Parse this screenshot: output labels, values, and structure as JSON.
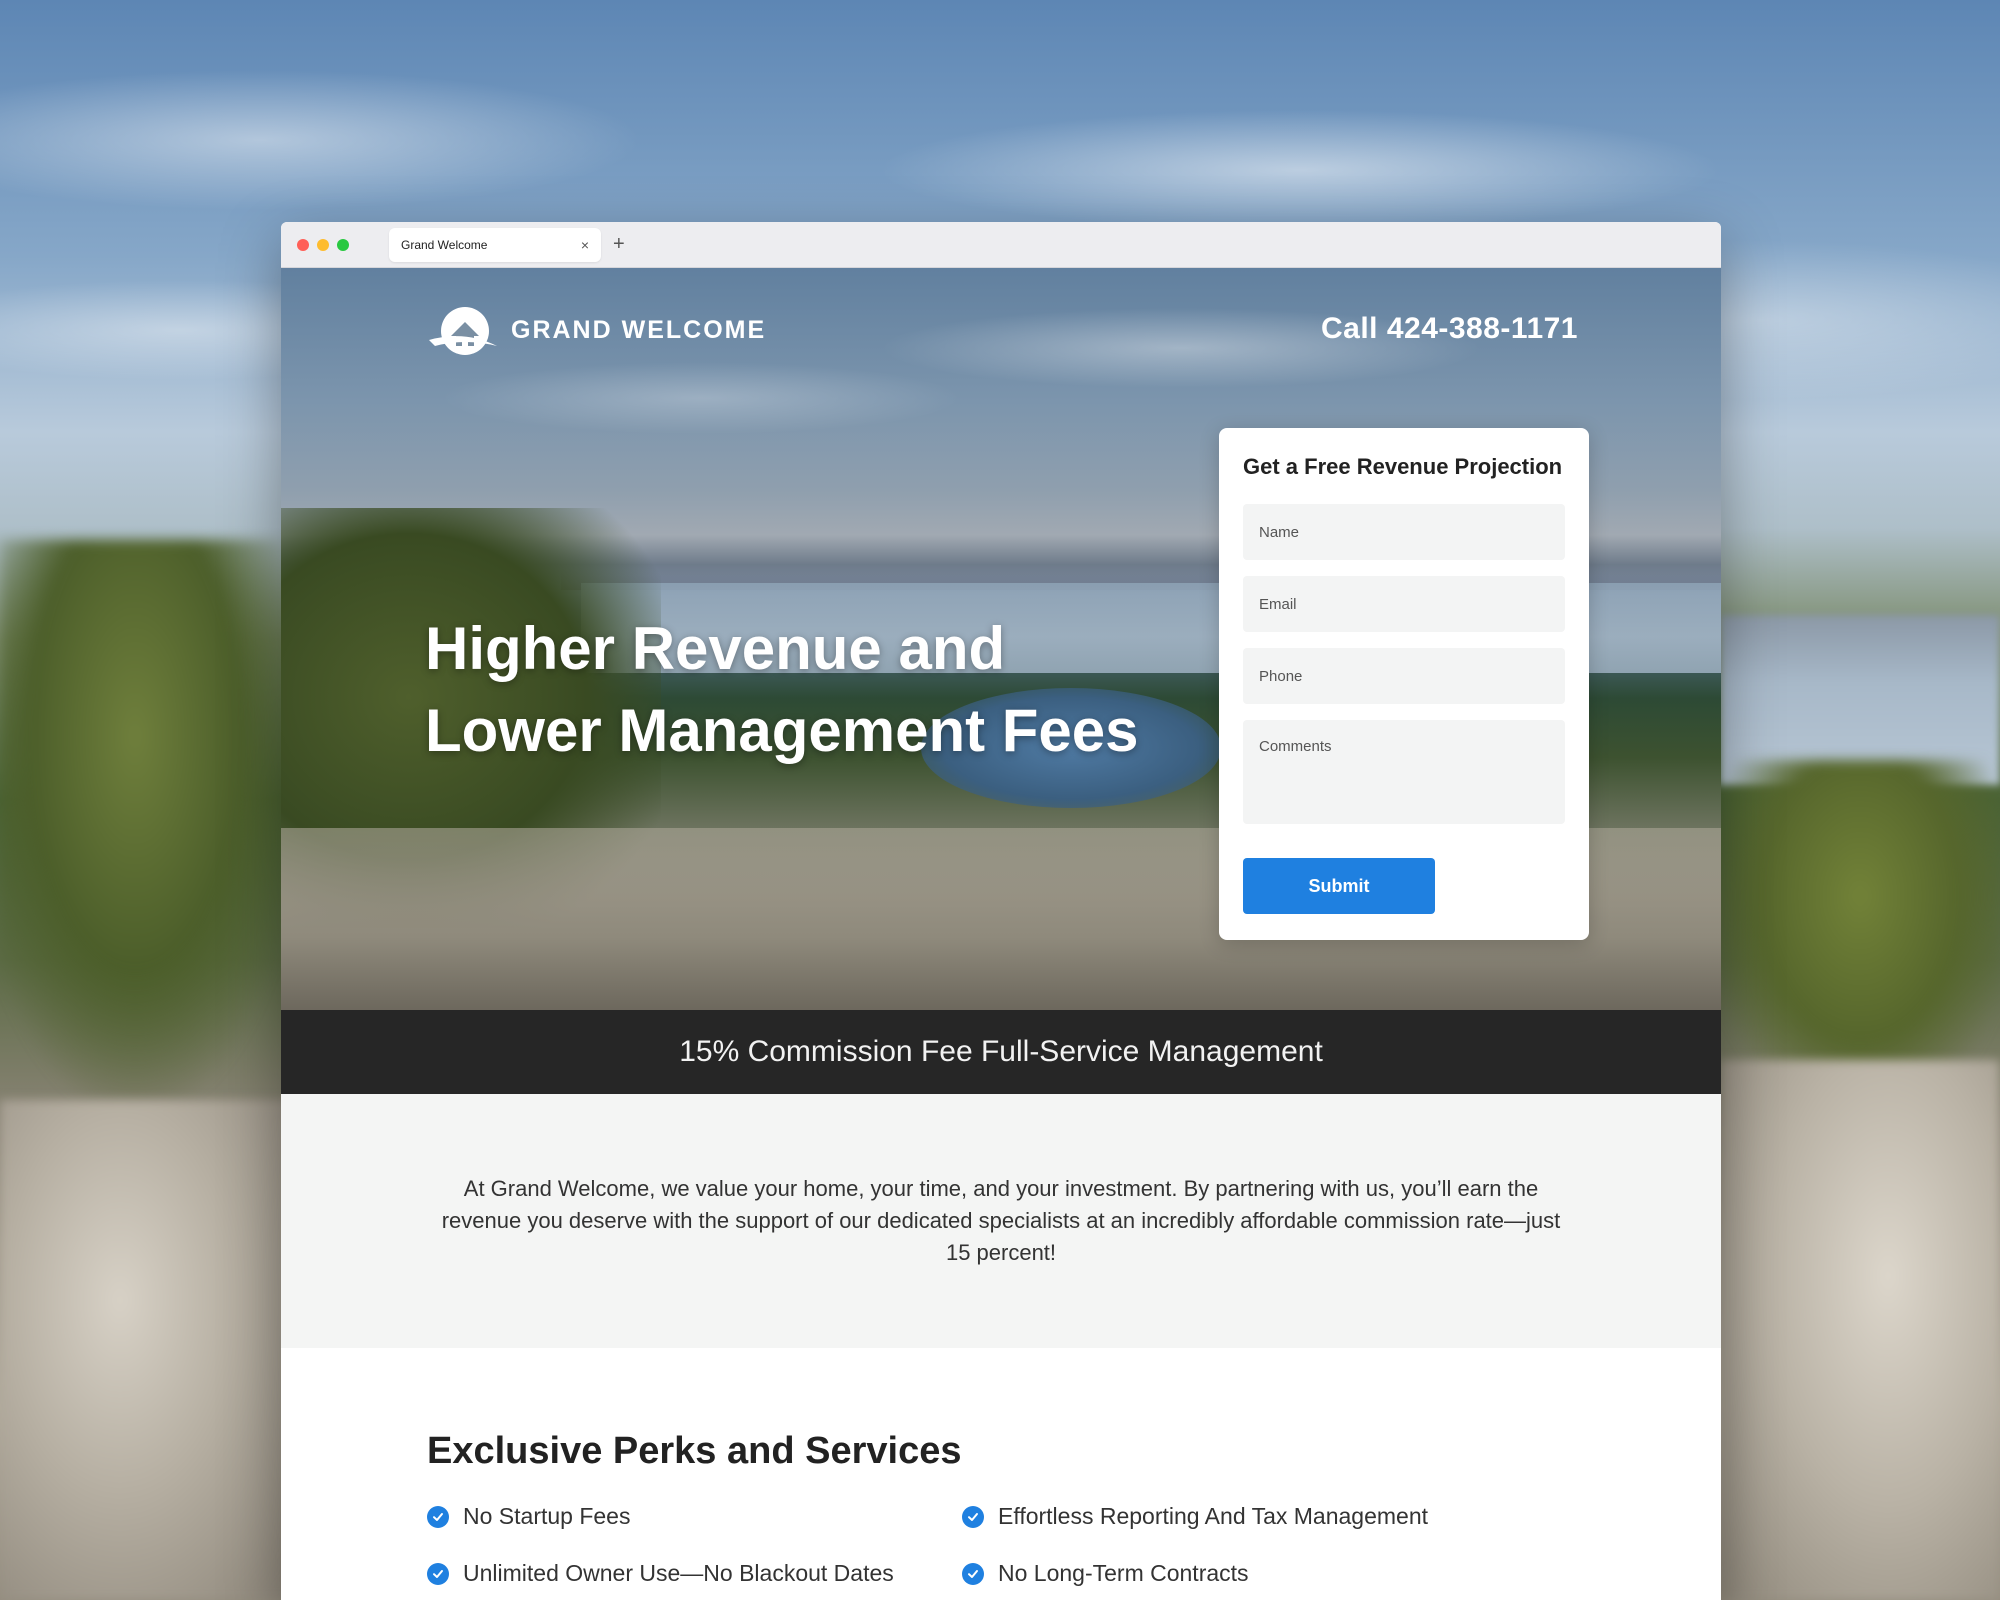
{
  "browser": {
    "tab_title": "Grand Welcome",
    "new_tab_symbol": "+",
    "close_symbol": "×"
  },
  "header": {
    "logo_text": "GRAND  WELCOME",
    "phone": "Call 424-388-1171"
  },
  "hero": {
    "headline_line1": "Higher Revenue and",
    "headline_line2": "Lower Management Fees"
  },
  "form": {
    "title": "Get a Free Revenue Projection",
    "name_placeholder": "Name",
    "email_placeholder": "Email",
    "phone_placeholder": "Phone",
    "comments_placeholder": "Comments",
    "submit_label": "Submit"
  },
  "band": {
    "text": "15% Commission Fee Full-Service Management"
  },
  "intro": {
    "text": "At Grand Welcome, we value your home, your time, and your investment. By partnering with us, you’ll earn the revenue you deserve with the support of our dedicated specialists at an incredibly affordable commission rate—just 15 percent!"
  },
  "perks": {
    "title": "Exclusive Perks and Services",
    "items": [
      "No Startup Fees",
      "Effortless Reporting And Tax Management",
      "Unlimited Owner Use—No Blackout Dates",
      "No Long-Term Contracts"
    ]
  },
  "colors": {
    "accent": "#1f80e0",
    "band": "#262626",
    "intro_bg": "#f4f5f4"
  }
}
